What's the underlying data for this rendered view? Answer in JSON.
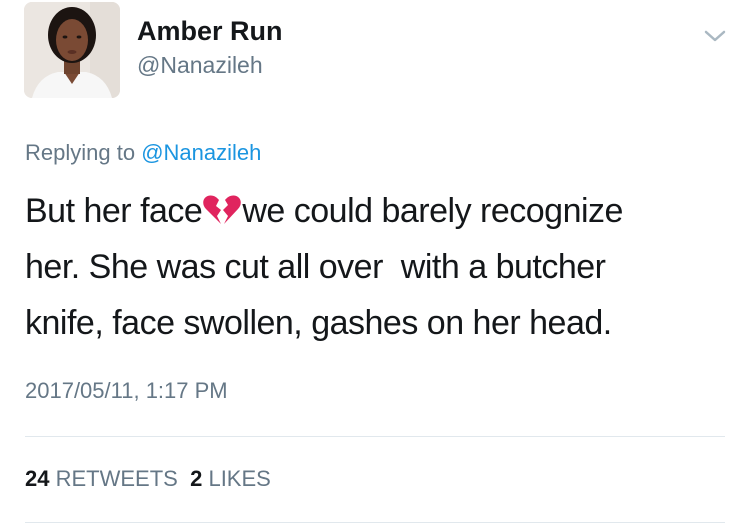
{
  "author": {
    "name": "Amber Run",
    "handle": "@Nanazileh"
  },
  "reply": {
    "prefix": "Replying to",
    "mention": "@Nanazileh"
  },
  "tweet": {
    "line1_before_emoji": "But her face",
    "emoji": "broken-heart-icon",
    "line1_after_emoji": "we could barely recognize",
    "line2": "her. She was cut all over  with a butcher",
    "line3": "knife, face swollen, gashes on her head."
  },
  "timestamp": "2017/05/11, 1:17 PM",
  "stats": {
    "retweets_count": "24",
    "retweets_label": "RETWEETS",
    "likes_count": "2",
    "likes_label": "LIKES"
  },
  "colors": {
    "text": "#14171a",
    "secondary": "#657786",
    "link": "#1b95e0",
    "divider": "#e1e8ed",
    "emoji_red": "#e0245e"
  }
}
